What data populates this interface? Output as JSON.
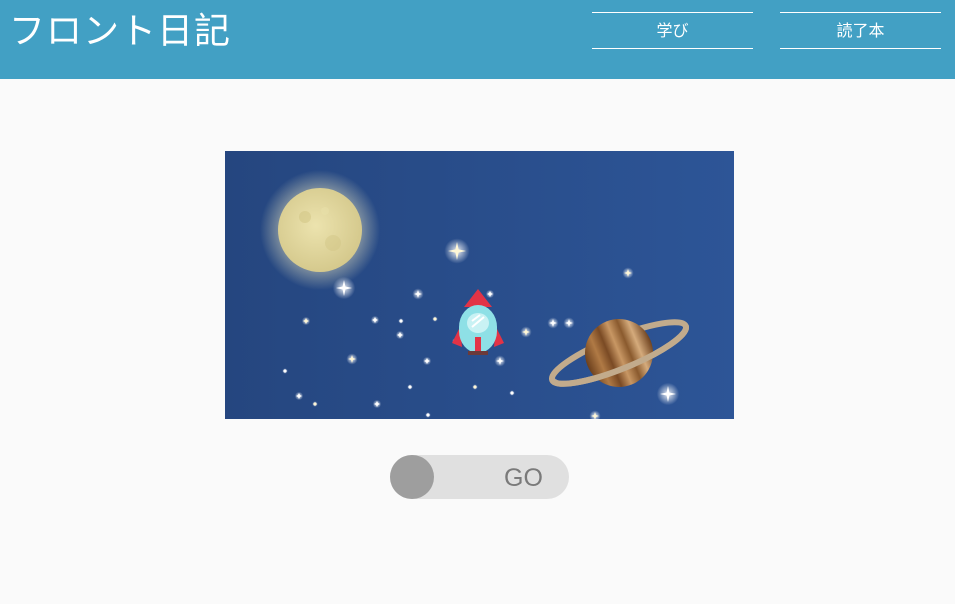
{
  "header": {
    "site_title": "フロント日記",
    "nav": [
      {
        "label": "学び"
      },
      {
        "label": "読了本"
      }
    ]
  },
  "toggle": {
    "label": "GO"
  },
  "colors": {
    "header_bg": "#42a0c4",
    "page_bg": "#fafafa",
    "sky": "#2a4f8e",
    "moon": "#ddd39a",
    "planet": "#8a5a2e",
    "planet_ring": "#c2ab8c",
    "rocket_body": "#8ee0e6",
    "rocket_nose": "#e23346",
    "toggle_track": "#e0e0e0",
    "toggle_knob": "#9e9e9e"
  },
  "icons": {
    "moon": "moon-icon",
    "rocket": "rocket-icon",
    "planet": "ringed-planet-icon",
    "stars": "star-icon"
  }
}
